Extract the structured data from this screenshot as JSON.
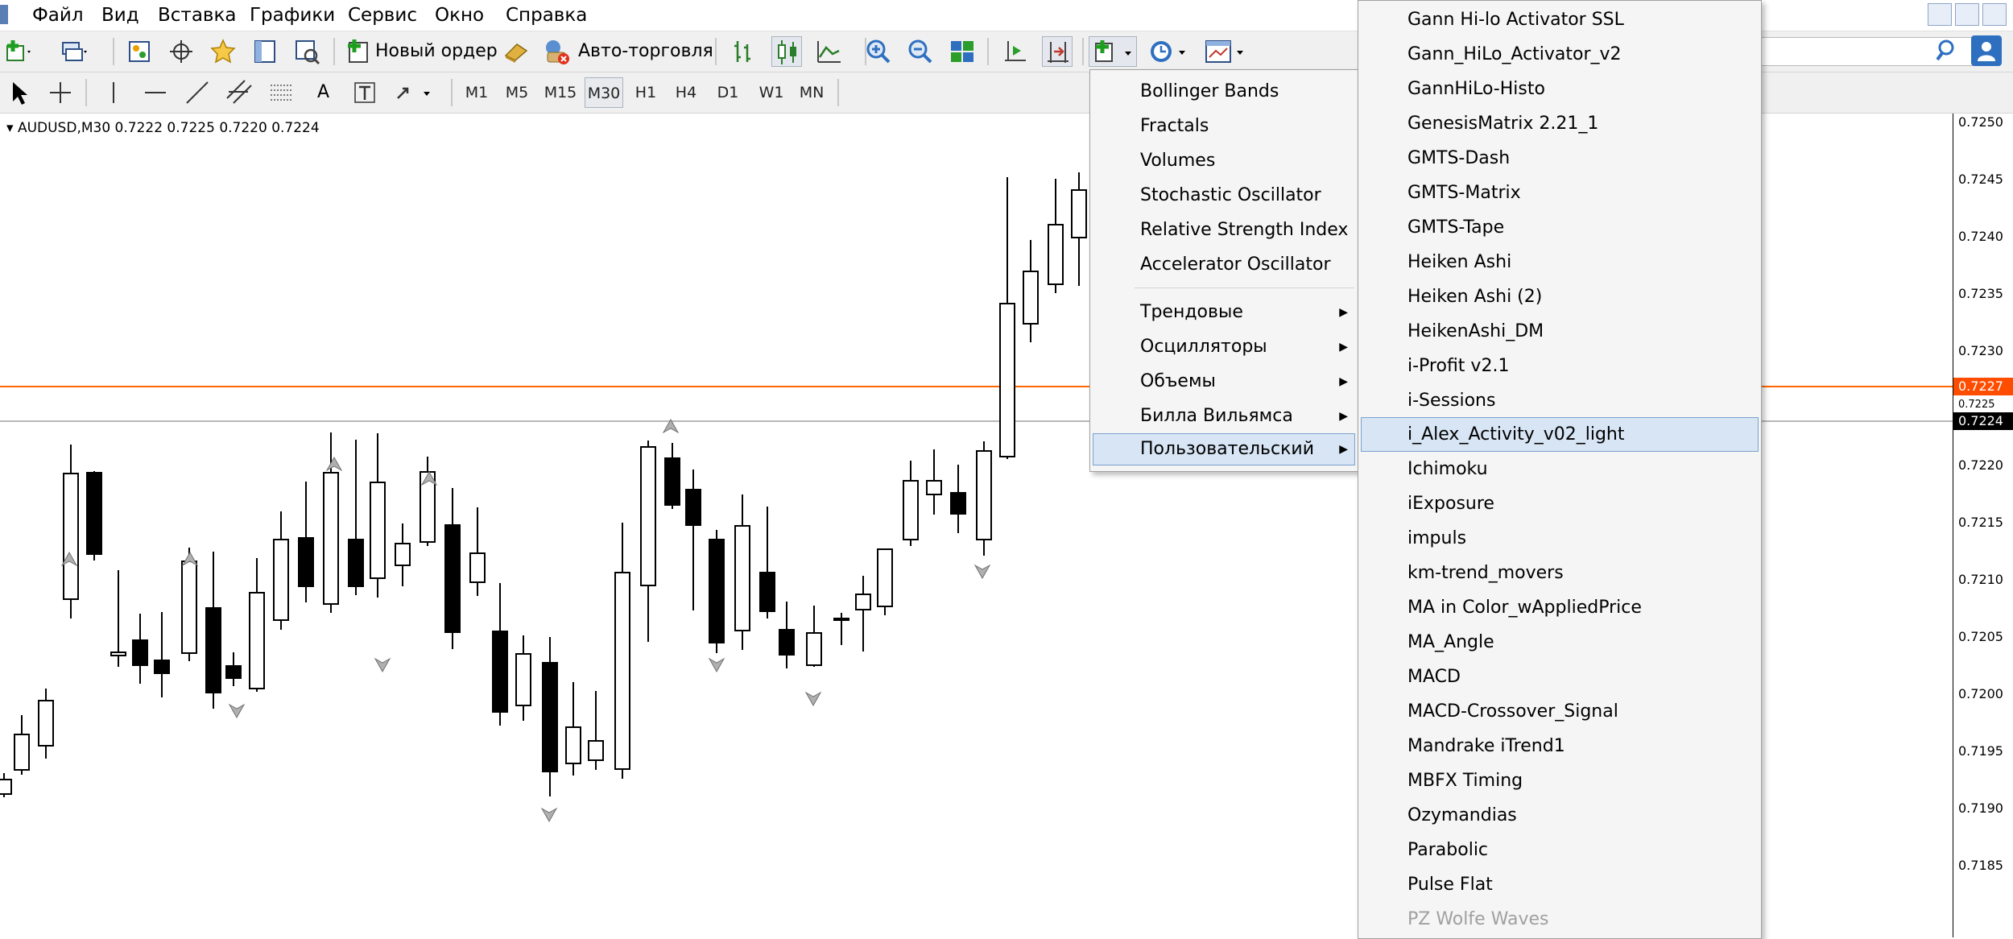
{
  "menubar": {
    "items": [
      "Файл",
      "Вид",
      "Вставка",
      "Графики",
      "Сервис",
      "Окно",
      "Справка"
    ]
  },
  "toolbar": {
    "new_order_label": "Новый ордер",
    "auto_trading_label": "Авто-торговля",
    "text_tool": "A",
    "timeframes": [
      "M1",
      "M5",
      "M15",
      "M30",
      "H1",
      "H4",
      "D1",
      "W1",
      "MN"
    ],
    "active_timeframe": "M30"
  },
  "chart": {
    "title": "AUDUSD,M30  0.7222 0.7225 0.7220 0.7224",
    "colors": {
      "line_orange": "#ff6600",
      "line_gray": "#a0a0a0",
      "badge_orange": "#ff4d00",
      "badge_black": "#000000"
    }
  },
  "price_axis": {
    "labels": [
      "0.7250",
      "0.7245",
      "0.7240",
      "0.7235",
      "0.7230",
      "0.7225",
      "0.7220",
      "0.7215",
      "0.7210",
      "0.7205",
      "0.7200",
      "0.7195",
      "0.7190",
      "0.7185"
    ],
    "ask_badge": "0.7227",
    "bid_badge": "0.7224"
  },
  "indicators_menu": {
    "items": [
      "Bollinger Bands",
      "Fractals",
      "Volumes",
      "Stochastic Oscillator",
      "Relative Strength Index",
      "Accelerator Oscillator"
    ],
    "submenus": [
      "Трендовые",
      "Осцилляторы",
      "Объемы",
      "Билла Вильямса",
      "Пользовательский"
    ],
    "highlighted": "Пользовательский"
  },
  "custom_menu": {
    "items": [
      "Gann Hi-lo Activator SSL",
      "Gann_HiLo_Activator_v2",
      "GannHiLo-Histo",
      "GenesisMatrix 2.21_1",
      "GMTS-Dash",
      "GMTS-Matrix",
      "GMTS-Tape",
      "Heiken Ashi",
      "Heiken Ashi (2)",
      "HeikenAshi_DM",
      "i-Profit v2.1",
      "i-Sessions",
      "i_Alex_Activity_v02_light",
      "Ichimoku",
      "iExposure",
      "impuls",
      "km-trend_movers",
      "MA in Color_wAppliedPrice",
      "MA_Angle",
      "MACD",
      "MACD-Crossover_Signal",
      "Mandrake iTrend1",
      "MBFX Timing",
      "Ozymandias",
      "Parabolic",
      "Pulse Flat",
      "PZ Wolfe Waves"
    ],
    "highlighted": "i_Alex_Activity_v02_light",
    "disabled": "PZ Wolfe Waves"
  }
}
